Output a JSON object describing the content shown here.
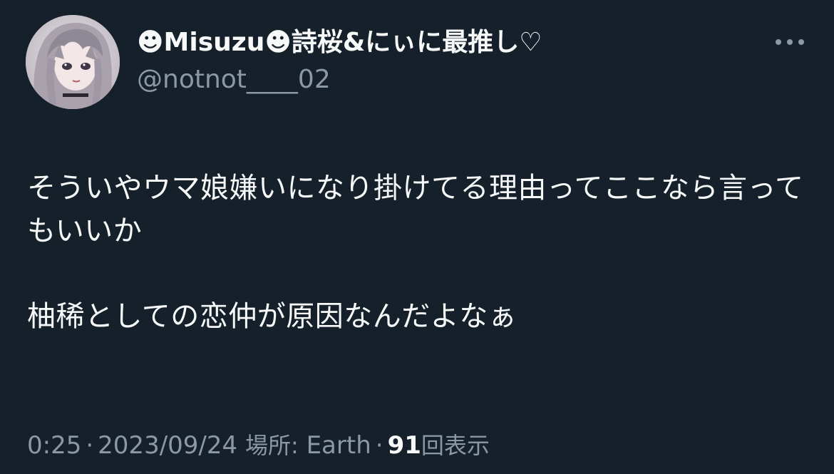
{
  "tweet": {
    "author": {
      "display_name": "☻Misuzu☻詩桜&にぃに最推し♡",
      "handle": "@notnot____02"
    },
    "text": "そういやウマ娘嫌いになり掛けてる理由ってここなら言ってもいいか\n\n柚稀としての恋仲が原因なんだよなぁ",
    "meta": {
      "time": "0:25",
      "separator": "·",
      "date": "2023/09/24",
      "location_label": "場所:",
      "location": "Earth",
      "views_count": "91",
      "views_label": "回表示"
    },
    "icons": {
      "more": "more-horizontal-icon",
      "avatar": "avatar-image"
    }
  },
  "colors": {
    "background": "#15202b",
    "text_primary": "#f7f9f9",
    "text_secondary": "#8b98a5"
  }
}
